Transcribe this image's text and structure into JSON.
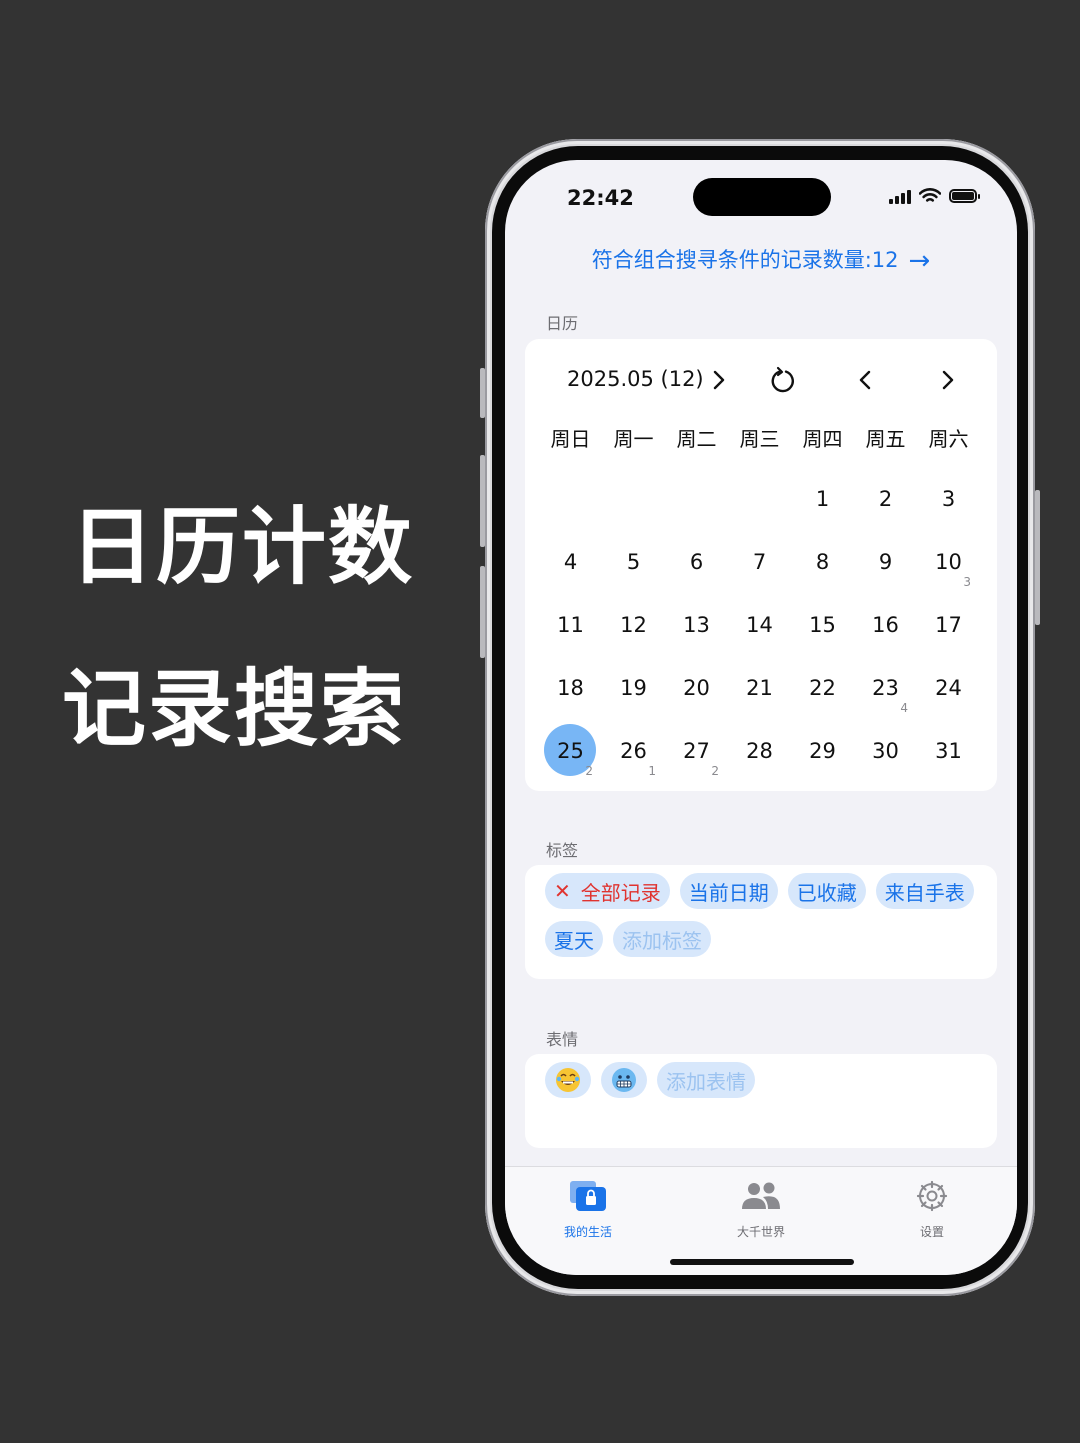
{
  "promo": {
    "line1": "日历计数",
    "line2": "记录搜索"
  },
  "status_bar": {
    "time": "22:42"
  },
  "search_result": {
    "text": "符合组合搜寻条件的记录数量:12",
    "arrow": "→"
  },
  "calendar": {
    "section_title": "日历",
    "month_label": "2025.05  (12)",
    "weekdays": [
      "周日",
      "周一",
      "周二",
      "周三",
      "周四",
      "周五",
      "周六"
    ],
    "leading_blanks": 4,
    "days": [
      {
        "d": "1"
      },
      {
        "d": "2"
      },
      {
        "d": "3"
      },
      {
        "d": "4"
      },
      {
        "d": "5"
      },
      {
        "d": "6"
      },
      {
        "d": "7"
      },
      {
        "d": "8"
      },
      {
        "d": "9"
      },
      {
        "d": "10",
        "count": "3"
      },
      {
        "d": "11"
      },
      {
        "d": "12"
      },
      {
        "d": "13"
      },
      {
        "d": "14"
      },
      {
        "d": "15"
      },
      {
        "d": "16"
      },
      {
        "d": "17"
      },
      {
        "d": "18"
      },
      {
        "d": "19"
      },
      {
        "d": "20"
      },
      {
        "d": "21"
      },
      {
        "d": "22"
      },
      {
        "d": "23",
        "count": "4"
      },
      {
        "d": "24"
      },
      {
        "d": "25",
        "count": "2",
        "selected": true
      },
      {
        "d": "26",
        "count": "1"
      },
      {
        "d": "27",
        "count": "2"
      },
      {
        "d": "28"
      },
      {
        "d": "29"
      },
      {
        "d": "30"
      },
      {
        "d": "31"
      }
    ],
    "selected_color": "#78b6f5"
  },
  "tags": {
    "section_title": "标签",
    "items": [
      {
        "label": "全部记录",
        "style": "red",
        "removable": true
      },
      {
        "label": "当前日期",
        "style": "normal"
      },
      {
        "label": "已收藏",
        "style": "normal"
      },
      {
        "label": "来自手表",
        "style": "normal"
      },
      {
        "label": "夏天",
        "style": "normal"
      },
      {
        "label": "添加标签",
        "style": "faded"
      }
    ]
  },
  "emotions": {
    "section_title": "表情",
    "items": [
      "laughing-tears-emoji-icon",
      "cold-face-emoji-icon"
    ],
    "add_label": "添加表情"
  },
  "tabbar": {
    "items": [
      {
        "label": "我的生活",
        "icon": "my-life-icon",
        "active": true
      },
      {
        "label": "大千世界",
        "icon": "people-icon",
        "active": false
      },
      {
        "label": "设置",
        "icon": "gear-icon",
        "active": false
      }
    ]
  },
  "colors": {
    "accent": "#1a73e8",
    "chip_bg": "#d7e7fb",
    "danger": "#e0332f",
    "background": "#333333"
  }
}
